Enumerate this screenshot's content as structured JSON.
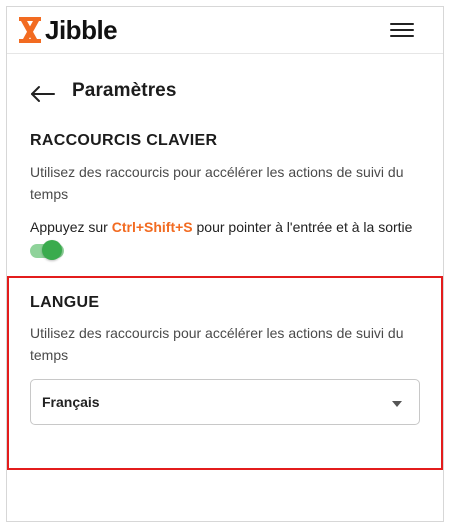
{
  "brand": {
    "name": "Jibble",
    "accent_color": "#f26b21"
  },
  "header": {
    "menu_icon": "hamburger-icon"
  },
  "page": {
    "back_icon": "arrow-left-icon",
    "title": "Paramètres"
  },
  "shortcuts": {
    "title": "RACCOURCIS CLAVIER",
    "description": "Utilisez des raccourcis pour accélérer les actions de suivi du temps",
    "line_prefix": "Appuyez sur ",
    "key_combo": "Ctrl+Shift+S",
    "line_suffix": " pour pointer à l'entrée et à la sortie",
    "toggle_on": true,
    "toggle_color": "#3aab4d"
  },
  "language": {
    "title": "LANGUE",
    "description": "Utilisez des raccourcis pour accélérer les actions de suivi du temps",
    "selected": "Français",
    "caret_icon": "caret-down-icon",
    "highlight_color": "#e31c1c"
  }
}
